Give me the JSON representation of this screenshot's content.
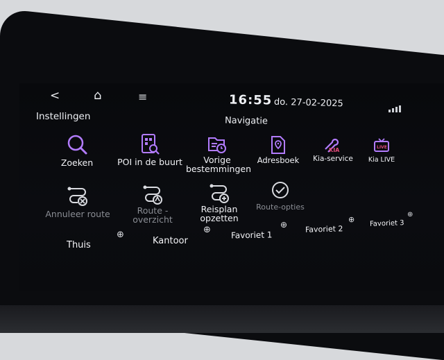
{
  "status": {
    "time": "16:55",
    "date": "do. 27-02-2025"
  },
  "header": {
    "section": "Instellingen",
    "title": "Navigatie"
  },
  "tiles": [
    {
      "label": "Zoeken",
      "icon": "search-icon",
      "color": "#b37cff"
    },
    {
      "label": "POI in de buurt",
      "icon": "poi-icon",
      "color": "#b37cff"
    },
    {
      "label": "Vorige bestemmingen",
      "icon": "history-folder-icon",
      "color": "#b37cff"
    },
    {
      "label": "Adresboek",
      "icon": "address-book-icon",
      "color": "#b37cff"
    },
    {
      "label": "Kia-service",
      "icon": "kia-service-icon",
      "color": "#b37cff"
    },
    {
      "label": "Kia LIVE",
      "icon": "kia-live-icon",
      "color": "#b37cff"
    },
    {
      "label": "Annuleer route",
      "icon": "cancel-route-icon",
      "color": "#d9dbe0",
      "dim": true
    },
    {
      "label": "Route -overzicht",
      "icon": "route-overview-icon",
      "color": "#d9dbe0",
      "dim": true
    },
    {
      "label": "Reisplan opzetten",
      "icon": "plan-trip-icon",
      "color": "#d9dbe0"
    },
    {
      "label": "Route-opties",
      "icon": "route-options-icon",
      "color": "#d9dbe0",
      "dim": true
    }
  ],
  "favorites": [
    {
      "label": "Thuis"
    },
    {
      "label": "Kantoor"
    },
    {
      "label": "Favoriet 1"
    },
    {
      "label": "Favoriet 2"
    },
    {
      "label": "Favoriet 3"
    }
  ],
  "glyphs": {
    "back": "<",
    "home": "⌂",
    "menu": "≡",
    "add": "⊕"
  }
}
